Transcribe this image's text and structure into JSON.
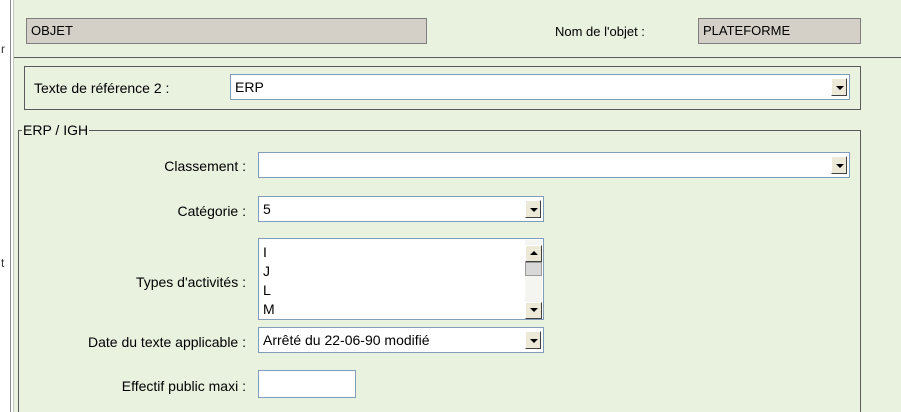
{
  "left_edge_chars": [
    "r",
    "t"
  ],
  "header": {
    "object_field_value": "OBJET",
    "object_name_label": "Nom de l'objet :",
    "object_name_value": "PLATEFORME"
  },
  "reference": {
    "label": "Texte de référence 2 :",
    "value": "ERP"
  },
  "group": {
    "title": "ERP / IGH",
    "classement_label": "Classement :",
    "classement_value": "",
    "categorie_label": "Catégorie :",
    "categorie_value": "5",
    "types_label": "Types d'activités :",
    "types_items": [
      "I",
      "J",
      "L",
      "M"
    ],
    "date_label": "Date du texte applicable :",
    "date_value": "Arrêté du 22-06-90 modifié",
    "effectif_label": "Effectif public maxi :",
    "effectif_value": ""
  },
  "colors": {
    "panel_background": "#e9f1df",
    "readonly_field": "#d4d0c8",
    "input_border": "#7f9db9"
  }
}
